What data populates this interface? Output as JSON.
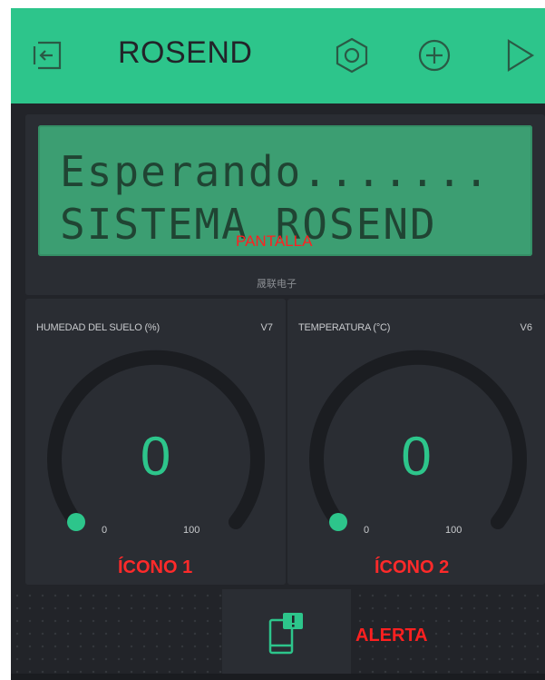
{
  "header": {
    "title": "ROSEND",
    "icons": [
      "exit-icon",
      "settings-hexagon-icon",
      "add-circle-icon",
      "play-icon"
    ],
    "background": "#2dc58b"
  },
  "lcd": {
    "line1": "Esperando.......",
    "line2": "SISTEMA ROSEND",
    "annotation": "PANTALLA",
    "caption": "晟联电子"
  },
  "gauges": [
    {
      "label": "HUMEDAD DEL SUELO (%)",
      "pin": "V7",
      "value": "0",
      "min": "0",
      "max": "100",
      "annotation": "ÍCONO 1"
    },
    {
      "label": "TEMPERATURA (°C)",
      "pin": "V6",
      "value": "0",
      "min": "0",
      "max": "100",
      "annotation": "ÍCONO 2"
    }
  ],
  "alert": {
    "icon": "phone-notification-icon",
    "annotation": "ALERTA"
  },
  "colors": {
    "accent": "#2dc58b",
    "background": "#222429",
    "panel": "#2a2d33",
    "annotation_red": "#ff2020"
  }
}
